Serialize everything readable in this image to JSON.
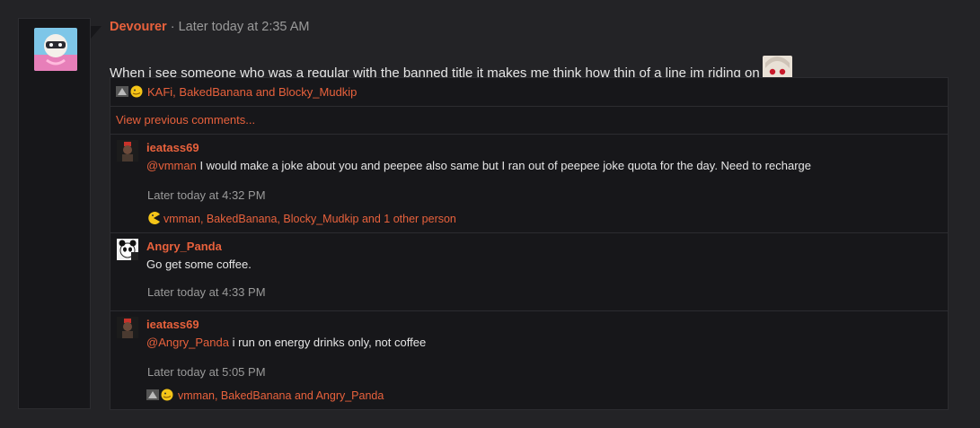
{
  "post": {
    "author": "Devourer",
    "separator": " · ",
    "timestamp": "Later today at 2:35 AM",
    "text": "When i see someone who was a regular with the banned title it makes me think how thin of a line im riding on",
    "reactions_text": "KAFi, BakedBanana and Blocky_Mudkip",
    "view_previous": "View previous comments..."
  },
  "comments": [
    {
      "author": "ieatass69",
      "mention": "@vmman",
      "text": " I would make a joke about you and peepee also same but I ran out of peepee joke quota for the day. Need to recharge",
      "time": "Later today at 4:32 PM",
      "reactions": "vmman, BakedBanana, Blocky_Mudkip and 1 other person"
    },
    {
      "author": "Angry_Panda",
      "mention": "",
      "text": "Go get some coffee.",
      "time": "Later today at 4:33 PM",
      "reactions": ""
    },
    {
      "author": "ieatass69",
      "mention": "@Angry_Panda",
      "text": " i run on energy drinks only, not coffee",
      "time": "Later today at 5:05 PM",
      "reactions": "vmman, BakedBanana and Angry_Panda"
    }
  ],
  "colors": {
    "accent": "#e8613c",
    "panel": "#17171a",
    "page": "#232326"
  }
}
